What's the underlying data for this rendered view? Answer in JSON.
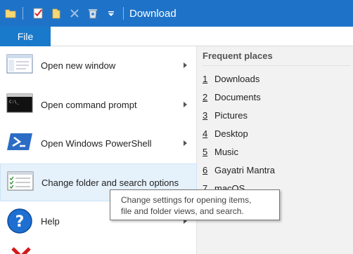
{
  "window": {
    "title": "Download"
  },
  "ribbon": {
    "file_tab": "File"
  },
  "menu": {
    "items": [
      {
        "label": "Open new window",
        "icon": "new-window-icon",
        "has_submenu": true
      },
      {
        "label": "Open command prompt",
        "icon": "command-prompt-icon",
        "has_submenu": true
      },
      {
        "label": "Open Windows PowerShell",
        "icon": "powershell-icon",
        "has_submenu": true
      },
      {
        "label": "Change folder and search options",
        "icon": "folder-options-icon",
        "has_submenu": false
      },
      {
        "label": "Help",
        "icon": "help-icon",
        "has_submenu": true
      }
    ]
  },
  "frequent_places": {
    "header": "Frequent places",
    "items": [
      {
        "num": "1",
        "label": "Downloads"
      },
      {
        "num": "2",
        "label": "Documents"
      },
      {
        "num": "3",
        "label": "Pictures"
      },
      {
        "num": "4",
        "label": "Desktop"
      },
      {
        "num": "5",
        "label": "Music"
      },
      {
        "num": "6",
        "label": "Gayatri Mantra"
      },
      {
        "num": "7",
        "label": "macOS"
      }
    ]
  },
  "tooltip": {
    "line1": "Change settings for opening items,",
    "line2": "file and folder views, and search."
  },
  "colors": {
    "titlebar": "#1e73c9",
    "file_tab": "#1979ca",
    "hover": "#e5f1fb"
  }
}
